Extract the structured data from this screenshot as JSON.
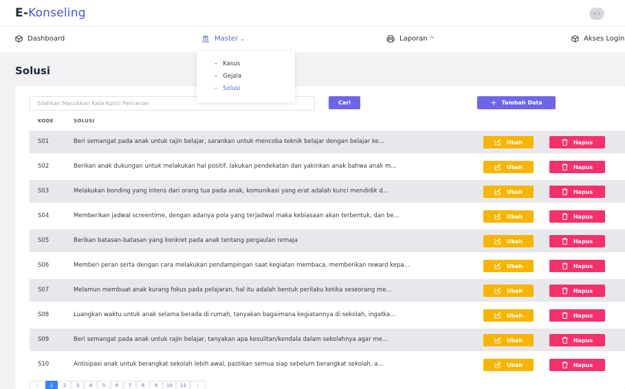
{
  "brand": {
    "prefix": "E-",
    "name": "Konseling"
  },
  "avatar_text": "o o",
  "nav": {
    "dashboard": "Dashboard",
    "master": "Master",
    "laporan": "Laporan",
    "akses_login": "Akses Login"
  },
  "dropdown": {
    "items": [
      "Kasus",
      "Gejala",
      "Solusi"
    ],
    "active": "Solusi"
  },
  "page_title": "Solusi",
  "search": {
    "placeholder": "Silahkan Masukkan Kata Kunci Pencarian",
    "button": "Cari"
  },
  "add_button": "Tambah Data",
  "table": {
    "headers": [
      "KODE",
      "SOLUSI"
    ],
    "edit_label": "Ubah",
    "delete_label": "Hapus",
    "rows": [
      {
        "kode": "S01",
        "solusi": "Beri semangat pada anak untuk rajin belajar, sarankan untuk mencoba teknik belajar dengan belajar ke..."
      },
      {
        "kode": "S02",
        "solusi": "Berikan anak dukungan untuk melakukan hal positif, lakukan pendekatan dan yakinkan anak bahwa anak m..."
      },
      {
        "kode": "S03",
        "solusi": "Melakukan bonding yang intens dari orang tua pada anak, komunikasi yang erat adalah kunci mendidik d..."
      },
      {
        "kode": "S04",
        "solusi": "Memberikan jadwal screentime, dengan adanya pola yang terjadwal maka kebiasaan akan terbentuk, dan be..."
      },
      {
        "kode": "S05",
        "solusi": "Berikan batasan-batasan yang konkret pada anak tentang pergaulan remaja"
      },
      {
        "kode": "S06",
        "solusi": "Memberi peran serta dengan cara melakukan pendampingan saat kegiatan membaca, memberikan reward kepa..."
      },
      {
        "kode": "S07",
        "solusi": "Melamun membuat anak kurang fokus pada pelajaran, hal itu adalah bentuk perilaku ketika seseorang me..."
      },
      {
        "kode": "S08",
        "solusi": "Luangkan waktu untuk anak selama berada di rumah, tanyakan bagaimana kegiatannya di sekolah, ingatka..."
      },
      {
        "kode": "S09",
        "solusi": "Beri semangat pada anak untuk rajin belajar, tanyakan apa kesulitan/kendala dalam sekolahnya agar me..."
      },
      {
        "kode": "S10",
        "solusi": "Antisipasi anak untuk berangkat sekolah lebih awal, pastikan semua siap sebelum berangkat sekolah, a..."
      }
    ]
  },
  "pagination": {
    "prev": "‹",
    "next": "›",
    "pages": [
      "1",
      "2",
      "3",
      "4",
      "5",
      "6",
      "7",
      "8",
      "9",
      "10",
      "11"
    ],
    "active": "1"
  },
  "colors": {
    "accent": "#6d66e8",
    "edit": "#f6b500",
    "delete": "#f5306a",
    "page_active": "#3b82f6"
  }
}
